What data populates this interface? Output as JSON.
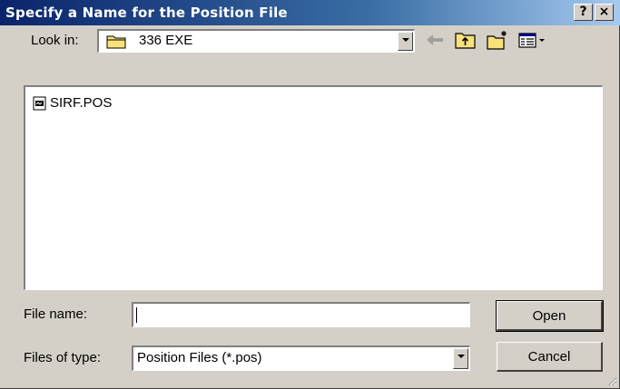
{
  "window": {
    "title": "Specify a Name for the Position File",
    "help_label": "?",
    "close_label": "×"
  },
  "lookin": {
    "label": "Look in:",
    "value": "336 EXE"
  },
  "toolbar": {
    "icons": [
      "back-arrow-icon",
      "up-folder-icon",
      "new-folder-icon",
      "view-menu-icon"
    ]
  },
  "files": [
    {
      "name": "SIRF.POS",
      "icon": "file-icon"
    }
  ],
  "filename": {
    "label": "File name:",
    "value": "",
    "placeholder": ""
  },
  "filetype": {
    "label": "Files of type:",
    "value": "Position Files (*.pos)"
  },
  "buttons": {
    "open": "Open",
    "cancel": "Cancel"
  },
  "colors": {
    "titlebar_start": "#0a246a",
    "titlebar_end": "#a6caf0",
    "face": "#d4d0c8"
  }
}
